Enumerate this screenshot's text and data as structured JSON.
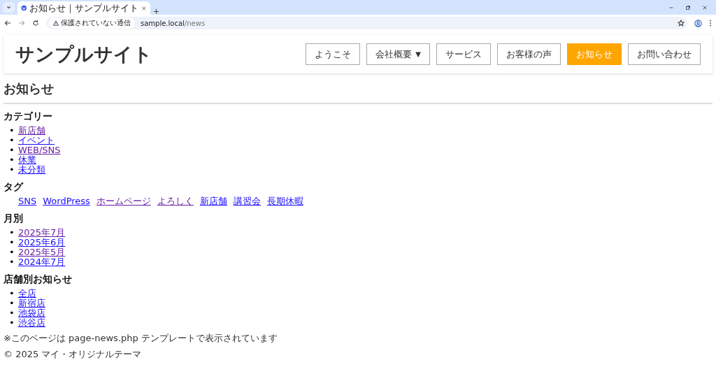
{
  "browser": {
    "tab_title": "お知らせ｜サンプルサイト",
    "security": "保護されていない通信",
    "url_host": "sample.local",
    "url_path": "/news"
  },
  "site": {
    "title": "サンプルサイト",
    "nav": [
      {
        "label": "ようこそ",
        "selected": false
      },
      {
        "label": "会社概要",
        "caret": "▼",
        "selected": false
      },
      {
        "label": "サービス",
        "selected": false
      },
      {
        "label": "お客様の声",
        "selected": false
      },
      {
        "label": "お知らせ",
        "selected": true
      },
      {
        "label": "お問い合わせ",
        "selected": false
      }
    ]
  },
  "page_title": "お知らせ",
  "sections": [
    {
      "heading": "カテゴリー",
      "kind": "list",
      "marker": "•",
      "links": [
        {
          "label": "新店舗",
          "visited": true
        },
        {
          "label": "イベント",
          "visited": false
        },
        {
          "label": "WEB/SNS",
          "visited": true
        },
        {
          "label": "休業",
          "visited": false
        },
        {
          "label": "未分類",
          "visited": false
        }
      ]
    },
    {
      "heading": "タグ",
      "kind": "inline",
      "links": [
        {
          "label": "SNS",
          "visited": false
        },
        {
          "label": "WordPress",
          "visited": false
        },
        {
          "label": "ホームページ",
          "visited": true
        },
        {
          "label": "よろしく",
          "visited": true
        },
        {
          "label": "新店舗",
          "visited": false
        },
        {
          "label": "講習会",
          "visited": false
        },
        {
          "label": "長期休暇",
          "visited": false
        }
      ]
    },
    {
      "heading": "月別",
      "kind": "list",
      "marker": "•",
      "links": [
        {
          "label": "2025年7月",
          "visited": true
        },
        {
          "label": "2025年6月",
          "visited": false
        },
        {
          "label": "2025年5月",
          "visited": true
        },
        {
          "label": "2024年7月",
          "visited": false
        }
      ]
    },
    {
      "heading": "店舗別お知らせ",
      "kind": "list",
      "marker": "•",
      "links": [
        {
          "label": "全店",
          "visited": false
        },
        {
          "label": "新宿店",
          "visited": false
        },
        {
          "label": "池袋店",
          "visited": false
        },
        {
          "label": "渋谷店",
          "visited": false
        }
      ]
    }
  ],
  "template_note": "※このページは page-news.php テンプレートで表示されています",
  "copyright": "© 2025 マイ・オリジナルテーマ"
}
